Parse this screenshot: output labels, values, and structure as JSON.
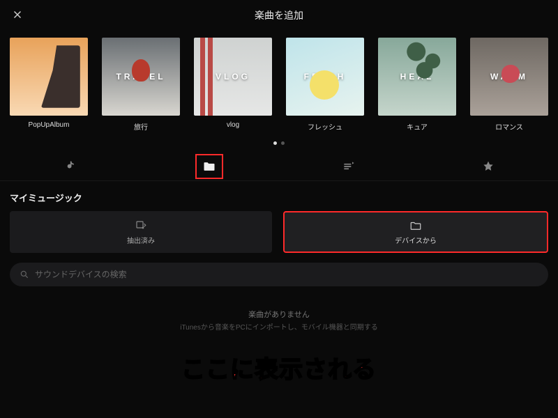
{
  "header": {
    "title": "楽曲を追加"
  },
  "categories": [
    {
      "label": "PopUpAlbum",
      "overlay": ""
    },
    {
      "label": "旅行",
      "overlay": "TRAVEL"
    },
    {
      "label": "vlog",
      "overlay": "VLOG"
    },
    {
      "label": "フレッシュ",
      "overlay": "FRESH"
    },
    {
      "label": "キュア",
      "overlay": "HEAL"
    },
    {
      "label": "ロマンス",
      "overlay": "WARM"
    }
  ],
  "pager": {
    "count": 2,
    "active": 0
  },
  "tabs": {
    "items": [
      "tiktok",
      "folder",
      "playlist",
      "star"
    ],
    "active": 1
  },
  "section": {
    "title": "マイミュージック"
  },
  "subtabs": {
    "extracted": {
      "label": "抽出済み"
    },
    "device": {
      "label": "デバイスから"
    },
    "active": "device"
  },
  "search": {
    "placeholder": "サウンドデバイスの検索",
    "value": ""
  },
  "empty": {
    "title": "楽曲がありません",
    "sub": "iTunesから音楽をPCにインポートし、モバイル機器と同期する"
  },
  "annotation": {
    "text": "ここに表示される"
  }
}
